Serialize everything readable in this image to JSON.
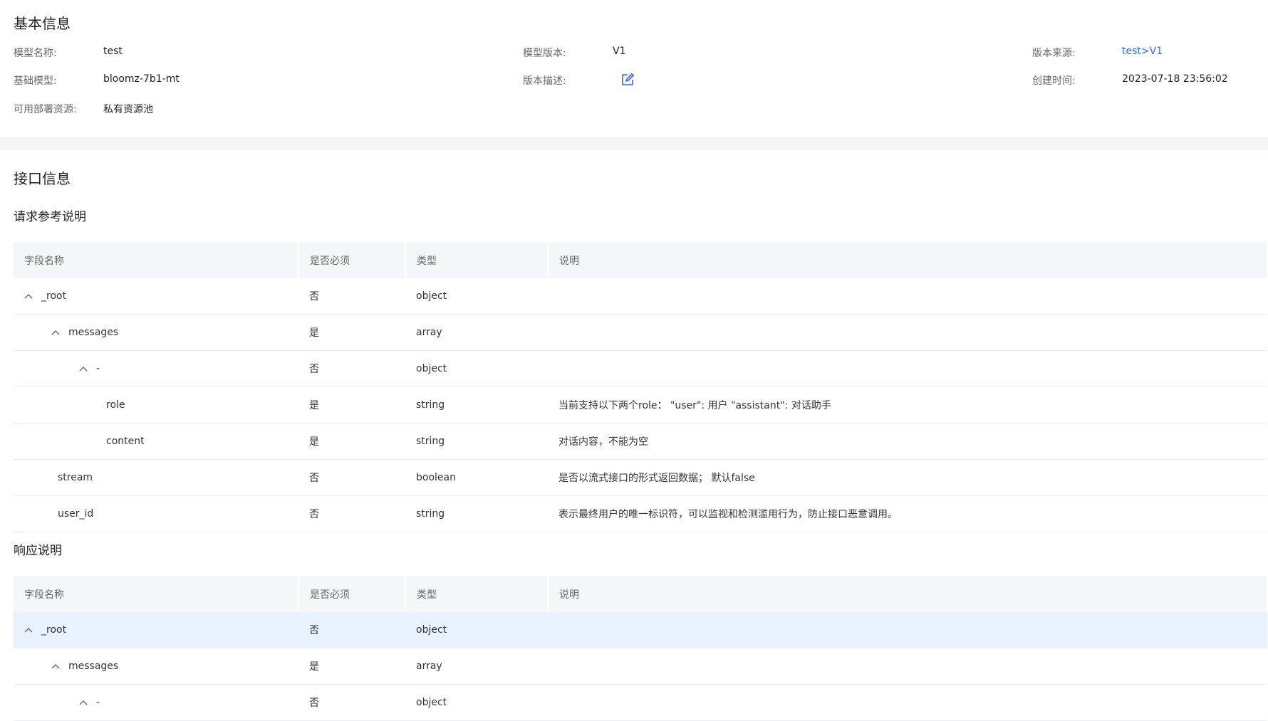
{
  "basic": {
    "title": "基本信息",
    "model_name_label": "模型名称:",
    "model_name": "test",
    "model_version_label": "模型版本:",
    "model_version": "V1",
    "version_source_label": "版本来源:",
    "version_source": "test>V1",
    "base_model_label": "基础模型:",
    "base_model": "bloomz-7b1-mt",
    "version_desc_label": "版本描述:",
    "version_desc_icon": "edit-icon",
    "created_label": "创建时间:",
    "created": "2023-07-18 23:56:02",
    "resource_label": "可用部署资源:",
    "resource": "私有资源池"
  },
  "api": {
    "title": "接口信息",
    "request_title": "请求参考说明",
    "response_title": "响应说明",
    "headers": [
      "字段名称",
      "是否必须",
      "类型",
      "说明"
    ],
    "request_rows": [
      {
        "name": "_root",
        "required": "否",
        "type": "object",
        "desc": "",
        "caret": true
      },
      {
        "name": "messages",
        "required": "是",
        "type": "array",
        "desc": "",
        "caret": true
      },
      {
        "name": "-",
        "required": "否",
        "type": "object",
        "desc": "",
        "caret": true
      },
      {
        "name": "role",
        "required": "是",
        "type": "string",
        "desc": "当前支持以下两个role： \"user\": 用户 \"assistant\": 对话助手",
        "caret": false
      },
      {
        "name": "content",
        "required": "是",
        "type": "string",
        "desc": "对话内容，不能为空",
        "caret": false
      },
      {
        "name": "stream",
        "required": "否",
        "type": "boolean",
        "desc": "是否以流式接口的形式返回数据； 默认false",
        "caret": false
      },
      {
        "name": "user_id",
        "required": "否",
        "type": "string",
        "desc": "表示最终用户的唯一标识符，可以监视和检测滥用行为，防止接口恶意调用。",
        "caret": false
      }
    ],
    "response_rows": [
      {
        "name": "_root",
        "required": "否",
        "type": "object",
        "desc": "",
        "caret": true
      },
      {
        "name": "messages",
        "required": "是",
        "type": "array",
        "desc": "",
        "caret": true
      },
      {
        "name": "-",
        "required": "否",
        "type": "object",
        "desc": "",
        "caret": true
      }
    ]
  },
  "colors": {
    "link": "#2e6be6",
    "highlight_row": "#e8f1fe",
    "header_bg": "#f5f6f8",
    "gap_bg": "#f4f5f6"
  }
}
